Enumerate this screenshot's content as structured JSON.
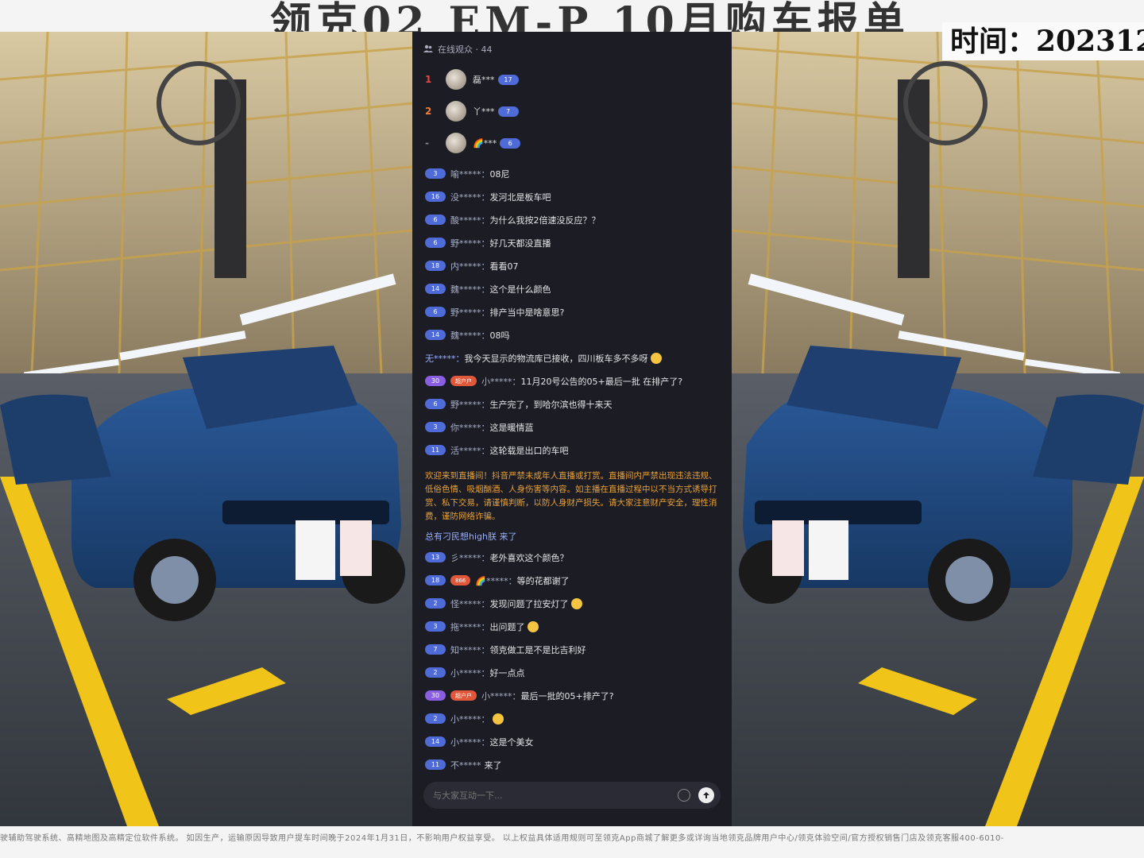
{
  "header": {
    "title": "领克02 EM-P 10月购车报单",
    "time_label": "时间：202312"
  },
  "chat": {
    "audience_label": "在线观众 · 44",
    "rankings": [
      {
        "rank": "1",
        "name": "磊***",
        "level": "17"
      },
      {
        "rank": "2",
        "name": "丫***",
        "level": "7"
      },
      {
        "rank": "-",
        "name": "🌈***",
        "level": "6"
      }
    ],
    "messages": [
      {
        "level": "3",
        "user": "喻*****：",
        "text": "08尼"
      },
      {
        "level": "16",
        "user": "没*****：",
        "text": "发河北是板车吧"
      },
      {
        "level": "6",
        "user": "酸*****：",
        "text": "为什么我按2倍速没反应？？"
      },
      {
        "level": "6",
        "user": "野*****：",
        "text": "好几天都没直播"
      },
      {
        "level": "18",
        "user": "内*****：",
        "text": "看看07"
      },
      {
        "level": "14",
        "user": "魏*****：",
        "text": "这个是什么颜色"
      },
      {
        "level": "6",
        "user": "野*****：",
        "text": "排产当中是啥意思?"
      },
      {
        "level": "14",
        "user": "魏*****：",
        "text": "08吗"
      },
      {
        "level": "",
        "user": "无*****：",
        "text": "我今天显示的物流库已接收，四川板车多不多呀"
      },
      {
        "level": "30",
        "user": "小*****：",
        "text": "11月20号公告的05+最后一批 在排产了?",
        "fan": "超户户"
      },
      {
        "level": "6",
        "user": "野*****：",
        "text": "生产完了，到哈尔滨也得十来天"
      },
      {
        "level": "3",
        "user": "你*****：",
        "text": "这是暖情蓝"
      },
      {
        "level": "11",
        "user": "活*****：",
        "text": "这轮载是出口的车吧"
      }
    ],
    "notice": "欢迎来到直播间！抖音严禁未成年人直播或打赏。直播间内严禁出现违法违规、低俗色情、吸烟酗酒、人身伤害等内容。如主播在直播过程中以不当方式诱导打赏、私下交易，请谨慎判断，以防人身财产损失。请大家注意财产安全，理性消费，谨防网络诈骗。",
    "enter_line": "总有刁民想high朕 来了",
    "messages2": [
      {
        "level": "13",
        "user": "彡*****：",
        "text": "老外喜欢这个颜色？"
      },
      {
        "level": "18",
        "user": "🌈*****：",
        "text": "等的花都谢了",
        "fan": "866"
      },
      {
        "level": "2",
        "user": "怪*****：",
        "text": "发现问题了拉安灯了"
      },
      {
        "level": "3",
        "user": "拖*****：",
        "text": "出问题了"
      },
      {
        "level": "7",
        "user": "知*****：",
        "text": "领克做工是不是比吉利好"
      },
      {
        "level": "2",
        "user": "小*****：",
        "text": "好一点点"
      },
      {
        "level": "30",
        "user": "小*****：",
        "text": "最后一批的05+排产了?",
        "fan": "超户户"
      },
      {
        "level": "2",
        "user": "小*****：",
        "text": ""
      },
      {
        "level": "14",
        "user": "小*****：",
        "text": "这是个美女"
      },
      {
        "level": "11",
        "user": "不*****",
        "text": "来了"
      }
    ],
    "input_placeholder": "与大家互动一下..."
  },
  "footer": {
    "text": "驶辅助驾驶系统、高精地图及高精定位软件系统。    如因生产，运输原因导致用户提车时间晚于2024年1月31日，不影响用户权益享受。    以上权益具体适用规则可至领克App商城了解更多或详询当地领克品牌用户中心/领克体验空间/官方授权销售门店及领克客服400-6010-"
  },
  "colors": {
    "chat_bg": "#1c1c24",
    "level_badge": "#4f6bd8",
    "notice": "#e6a23c",
    "rank1": "#e04848",
    "rank2": "#ef7d34"
  }
}
